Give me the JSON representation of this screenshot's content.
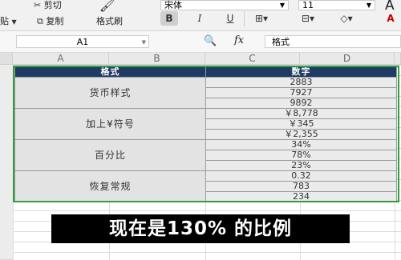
{
  "ribbon": {
    "cut_label": "剪切",
    "paste_label": "贴",
    "copy_label": "复制",
    "format_painter_label": "格式刷",
    "font_name": "宋体",
    "font_size": "11",
    "bold_label": "B",
    "italic_label": "I",
    "underline_label": "U",
    "font_color_label": "A"
  },
  "formula_bar": {
    "cell_ref": "A1",
    "fx_label": "fx",
    "content": "格式"
  },
  "columns": [
    "A",
    "B",
    "C",
    "D"
  ],
  "table": {
    "headers": [
      "格式",
      "数字"
    ],
    "groups": [
      {
        "label": "货币样式",
        "values": [
          "2883",
          "7927",
          "9892"
        ]
      },
      {
        "label": "加上¥符号",
        "values": [
          "￥8,778",
          "￥345",
          "￥2,355"
        ]
      },
      {
        "label": "百分比",
        "values": [
          "34%",
          "78%",
          "23%"
        ]
      },
      {
        "label": "恢复常规",
        "values": [
          "0.32",
          "783",
          "234"
        ]
      }
    ]
  },
  "caption": "现在是130% 的比例",
  "colors": {
    "header_bg": "#1f3a64",
    "selection": "#2e9e3e"
  }
}
